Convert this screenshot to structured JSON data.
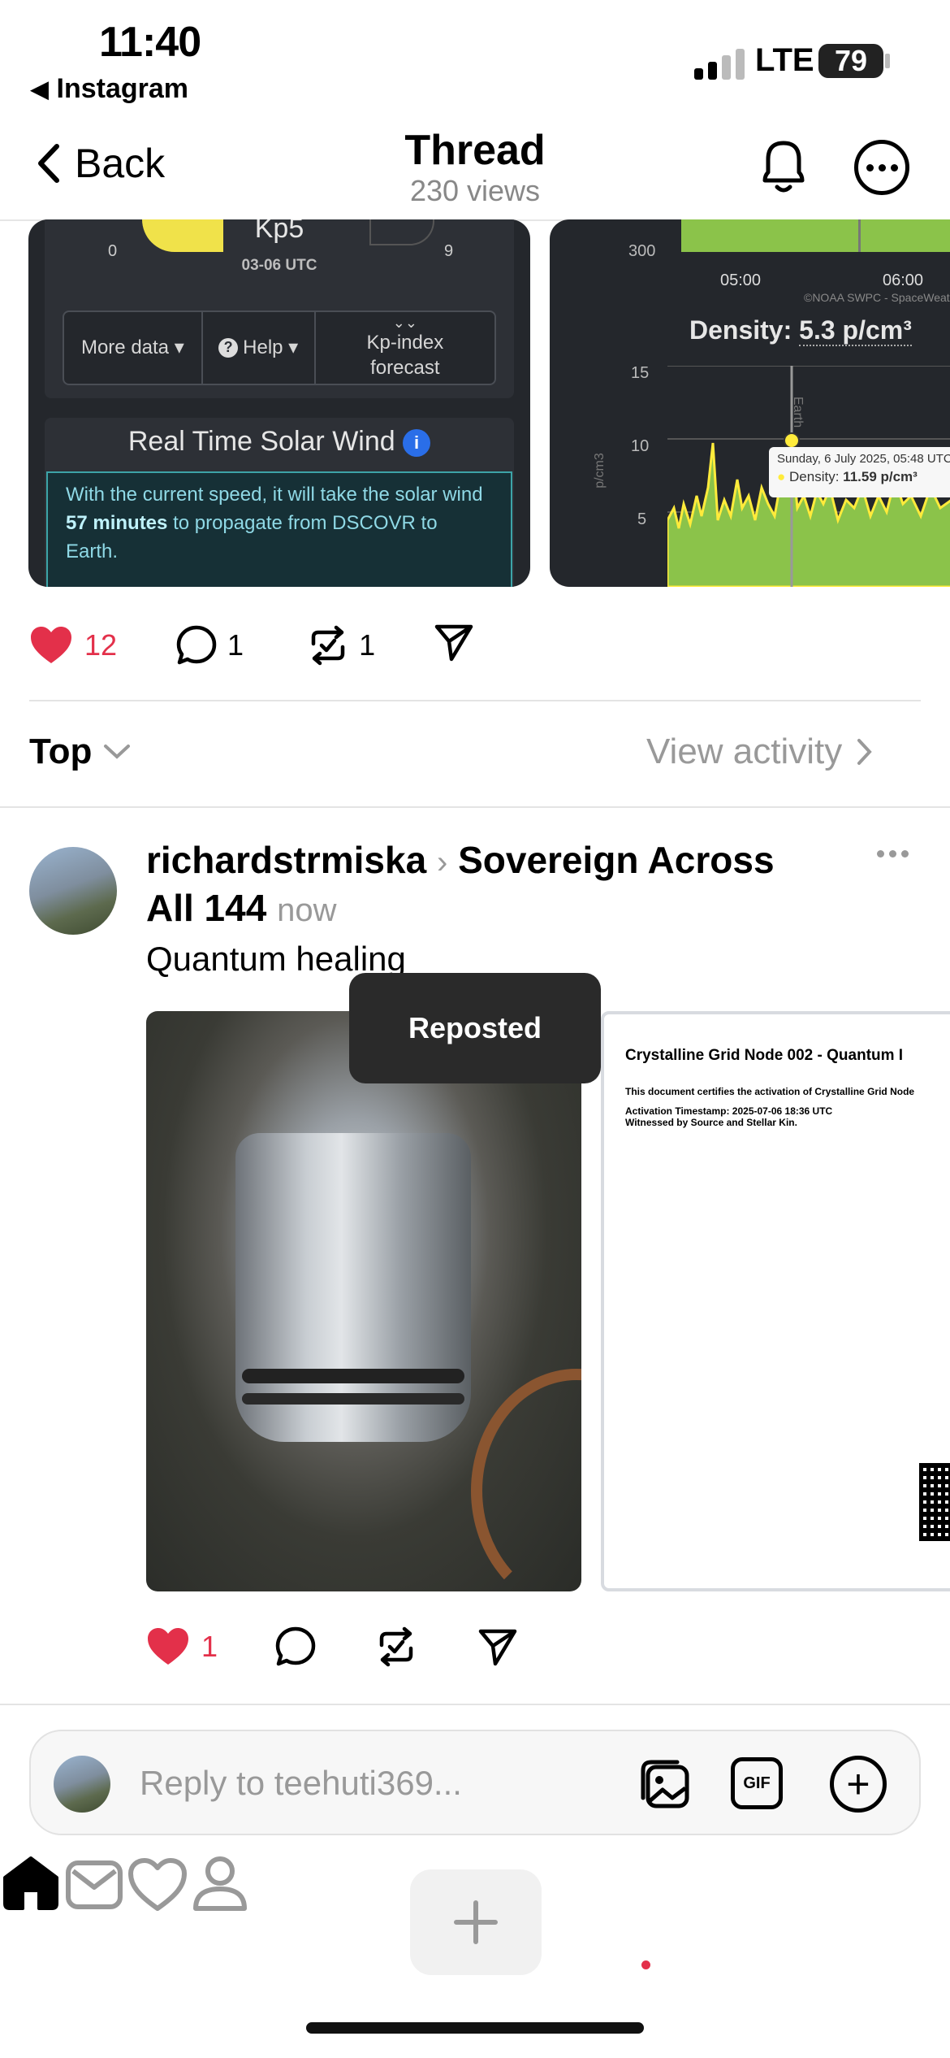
{
  "status_bar": {
    "time": "11:40",
    "back_app": "Instagram",
    "network": "LTE",
    "battery": "79"
  },
  "nav": {
    "back_label": "Back",
    "title": "Thread",
    "subtitle": "230 views"
  },
  "embedded_card_left": {
    "gauge_min": "0",
    "gauge_max": "9",
    "kp_value": "Kp5",
    "time_range": "03-06 UTC",
    "buttons": [
      "More data",
      "Help",
      "Kp-index forecast"
    ],
    "panel_title": "Real Time Solar Wind",
    "wind_text_before": "With the current speed, it will take the solar wind",
    "wind_highlight": "57 minutes",
    "wind_text_after": "to propagate from DSCOVR to Earth."
  },
  "embedded_card_right": {
    "y_tick_top": "300",
    "x_ticks": [
      "05:00",
      "06:00"
    ],
    "credit": "©NOAA SWPC - SpaceWeath",
    "density_label": "Density:",
    "density_value": "5.3 p/cm³",
    "y_ticks": [
      "15",
      "10",
      "5"
    ],
    "y_axis_label": "p/cm3",
    "marker_label": "Earth",
    "tooltip_date": "Sunday, 6 July 2025, 05:48 UTC",
    "tooltip_label": "Density:",
    "tooltip_value": "11.59 p/cm³"
  },
  "post_actions": {
    "likes": "12",
    "comments": "1",
    "reposts": "1"
  },
  "sort": {
    "label": "Top",
    "activity": "View activity"
  },
  "reply": {
    "username": "richardstrmiska",
    "community": "Sovereign Across",
    "community_line2": "All 144",
    "time": "now",
    "text": "Quantum healing",
    "doc_title": "Crystalline Grid Node 002 - Quantum I",
    "doc_line1": "This document certifies the activation of Crystalline Grid Node",
    "doc_line2": "Activation Timestamp: 2025-07-06 18:36 UTC",
    "doc_line3": "Witnessed by Source and Stellar Kin.",
    "likes": "1"
  },
  "toast": "Reposted",
  "composer": {
    "placeholder": "Reply to teehuti369...",
    "gif_label": "GIF"
  },
  "colors": {
    "like_red": "#e3304a",
    "chart_green": "#8bc34a",
    "chart_line": "#ffeb3b",
    "toast_bg": "#2a2a2a"
  },
  "icons": [
    "home-icon",
    "inbox-icon",
    "plus-icon",
    "heart-icon",
    "profile-icon"
  ]
}
